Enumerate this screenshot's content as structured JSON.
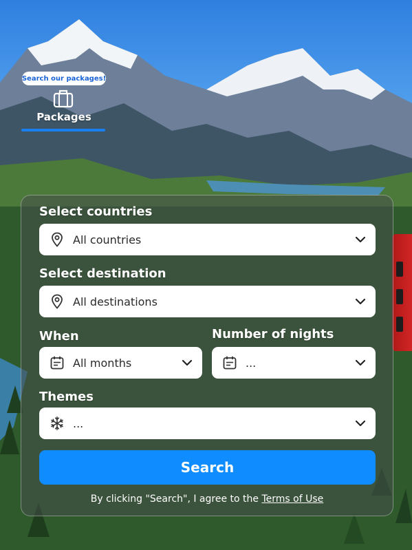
{
  "tab": {
    "badge": "Search our packages!",
    "label": "Packages",
    "icon": "suitcase-icon"
  },
  "form": {
    "countries_label": "Select countries",
    "countries_value": "All countries",
    "destination_label": "Select destination",
    "destination_value": "All destinations",
    "when_label": "When",
    "when_value": "All months",
    "nights_label": "Number of nights",
    "nights_value": "...",
    "themes_label": "Themes",
    "themes_value": "...",
    "search_label": "Search",
    "terms_prefix": "By clicking \"Search\", I agree to the ",
    "terms_link": "Terms of Use"
  },
  "icons": {
    "location": "map-pin-icon",
    "calendar": "calendar-icon",
    "theme": "snowflake-icon",
    "dropdown": "chevron-down-icon"
  },
  "colors": {
    "accent": "#0f8cff",
    "tab_underline": "#1a7ff0",
    "badge_text": "#1a63d6",
    "panel": "rgba(70,78,74,0.55)"
  }
}
